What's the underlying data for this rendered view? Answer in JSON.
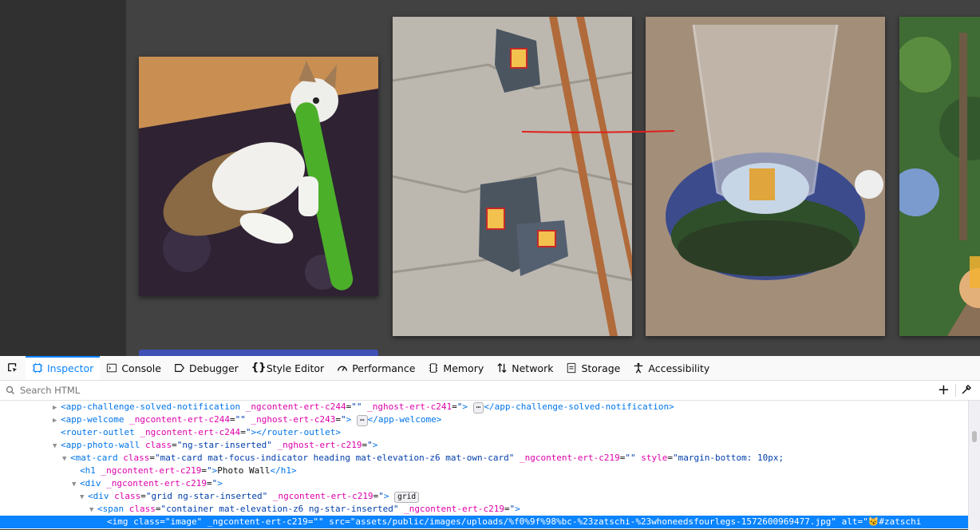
{
  "toolbar": {
    "picker_icon": "element-picker-icon",
    "tabs": [
      {
        "label": "Inspector",
        "icon": "inspector-icon",
        "active": true
      },
      {
        "label": "Console",
        "icon": "console-icon"
      },
      {
        "label": "Debugger",
        "icon": "debugger-icon"
      },
      {
        "label": "Style Editor",
        "icon": "braces-icon"
      },
      {
        "label": "Performance",
        "icon": "gauge-icon"
      },
      {
        "label": "Memory",
        "icon": "chip-icon"
      },
      {
        "label": "Network",
        "icon": "arrows-icon"
      },
      {
        "label": "Storage",
        "icon": "storage-icon"
      },
      {
        "label": "Accessibility",
        "icon": "accessibility-icon"
      }
    ]
  },
  "search": {
    "placeholder": "Search HTML"
  },
  "tree": {
    "l1": {
      "tag": "app-challenge-solved-notification",
      "a1": "_ngcontent-ert-c244",
      "v1": "\"\"",
      "a2": "_nghost-ert-c241",
      "v2": "\"",
      "close": "</app-challenge-solved-notification>"
    },
    "l2": {
      "tag": "app-welcome",
      "a1": "_ngcontent-ert-c244",
      "v1": "\"\"",
      "a2": "_nghost-ert-c243",
      "v2": "\"",
      "close": "</app-welcome>"
    },
    "l3": {
      "tag": "router-outlet",
      "a1": "_ngcontent-ert-c244",
      "v1": "\"",
      "close": "</router-outlet>"
    },
    "l4": {
      "tag": "app-photo-wall",
      "a1": "class",
      "v1": "\"ng-star-inserted\"",
      "a2": "_nghost-ert-c219",
      "v2": "\""
    },
    "l5": {
      "tag": "mat-card",
      "a1": "class",
      "v1": "\"mat-card mat-focus-indicator heading mat-elevation-z6 mat-own-card\"",
      "a2": "_ngcontent-ert-c219",
      "v2": "\"\"",
      "a3": "style",
      "v3": "\"margin-bottom: 10px;"
    },
    "l6": {
      "tag": "h1",
      "a1": "_ngcontent-ert-c219",
      "v1": "\"",
      "text": "Photo Wall",
      "close": "</h1>"
    },
    "l7": {
      "tag": "div",
      "a1": "_ngcontent-ert-c219",
      "v1": "\""
    },
    "l8": {
      "tag": "div",
      "a1": "class",
      "v1": "\"grid ng-star-inserted\"",
      "a2": "_ngcontent-ert-c219",
      "v2": "\"",
      "badge": "grid"
    },
    "l9": {
      "tag": "span",
      "a1": "class",
      "v1": "\"container mat-elevation-z6 ng-star-inserted\"",
      "a2": "_ngcontent-ert-c219",
      "v2": "\""
    },
    "l10": {
      "tag": "img",
      "a1": "class",
      "v1": "\"image\"",
      "a2": "_ngcontent-ert-c219",
      "v2": "\"\"",
      "a3": "src",
      "v3": "\"assets/public/images/uploads/%f0%9f%98%bc-%23zatschi-%23whoneedsfourlegs-1572600969477.jpg\"",
      "a4": "alt",
      "v4": "\"😼#zatschi"
    }
  },
  "colors": {
    "tag": "#0074e8",
    "attr": "#dd00a9",
    "value": "#003eaa",
    "selection": "#0a84ff",
    "annotation": "#e0201b"
  }
}
